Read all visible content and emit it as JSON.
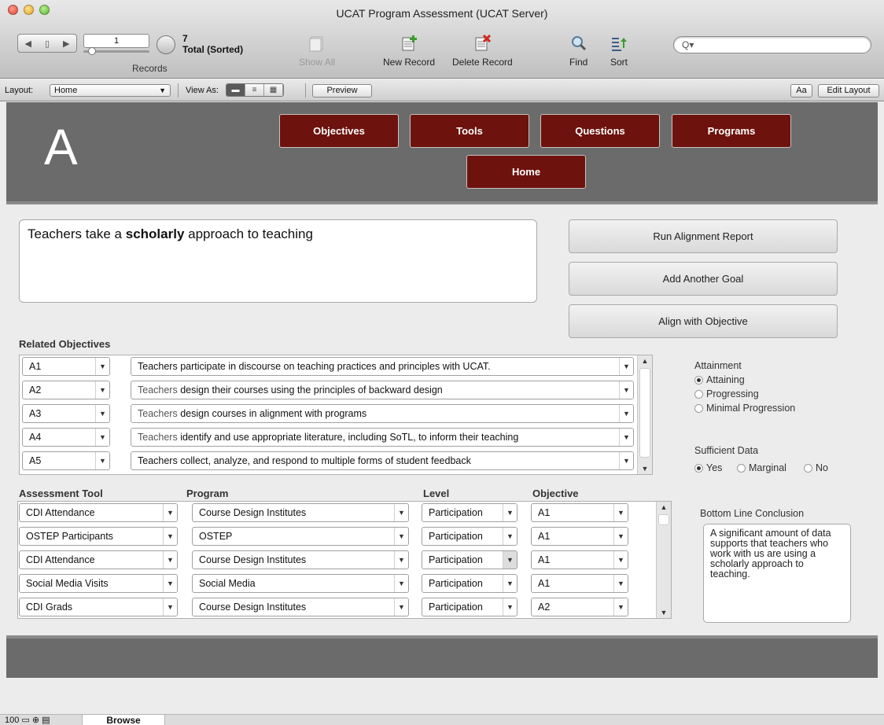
{
  "window": {
    "title": "UCAT Program Assessment (UCAT Server)"
  },
  "toolbar": {
    "record_number": "1",
    "total_count": "7",
    "total_label": "Total (Sorted)",
    "records_label": "Records",
    "show_all": "Show All",
    "new_record": "New Record",
    "delete_record": "Delete Record",
    "find": "Find",
    "sort": "Sort",
    "search_placeholder": "Q▾"
  },
  "layoutbar": {
    "layout_label": "Layout:",
    "layout_value": "Home",
    "view_as_label": "View As:",
    "preview": "Preview",
    "aa": "Aa",
    "edit_layout": "Edit Layout"
  },
  "header": {
    "letter": "A",
    "nav": [
      "Objectives",
      "Tools",
      "Questions",
      "Programs",
      "Home"
    ]
  },
  "goal": {
    "prefix": "Teachers take a ",
    "bold": "scholarly",
    "suffix": " approach to teaching"
  },
  "actions": [
    "Run Alignment Report",
    "Add Another Goal",
    "Align with Objective"
  ],
  "related_objectives": {
    "label": "Related Objectives",
    "rows": [
      {
        "code": "A1",
        "text_pre": "",
        "text": "Teachers participate in discourse on teaching practices and principles with UCAT."
      },
      {
        "code": "A2",
        "text_pre": "Teachers",
        "text": " design their courses using the principles of backward design"
      },
      {
        "code": "A3",
        "text_pre": "Teachers",
        "text": " design courses in alignment with programs"
      },
      {
        "code": "A4",
        "text_pre": "Teachers",
        "text": " identify and use appropriate literature, including SoTL, to inform their teaching"
      },
      {
        "code": "A5",
        "text_pre": "",
        "text": "Teachers collect, analyze, and respond to multiple forms of student feedback"
      }
    ]
  },
  "attainment": {
    "label": "Attainment",
    "options": [
      "Attaining",
      "Progressing",
      "Minimal Progression"
    ],
    "selected": 0
  },
  "sufficient_data": {
    "label": "Sufficient Data",
    "options": [
      "Yes",
      "Marginal",
      "No"
    ],
    "selected": 0
  },
  "assessment": {
    "headers": [
      "Assessment Tool",
      "Program",
      "Level",
      "Objective"
    ],
    "rows": [
      {
        "tool": "CDI Attendance",
        "program": "Course Design Institutes",
        "level": "Participation",
        "objective": "A1"
      },
      {
        "tool": "OSTEP Participants",
        "program": "OSTEP",
        "level": "Participation",
        "objective": "A1"
      },
      {
        "tool": "CDI Attendance",
        "program": "Course Design Institutes",
        "level": "Participation",
        "objective": "A1"
      },
      {
        "tool": "Social Media Visits",
        "program": "Social Media",
        "level": "Participation",
        "objective": "A1"
      },
      {
        "tool": "CDI Grads",
        "program": "Course Design Institutes",
        "level": "Participation",
        "objective": "A2"
      }
    ]
  },
  "conclusion": {
    "label": "Bottom Line Conclusion",
    "text": "A significant amount of data supports that teachers who work with us are using a scholarly approach to teaching."
  },
  "status": {
    "zoom": "100",
    "mode": "Browse"
  },
  "colors": {
    "nav_button": "#6d120d",
    "band": "#6b6b6b"
  }
}
